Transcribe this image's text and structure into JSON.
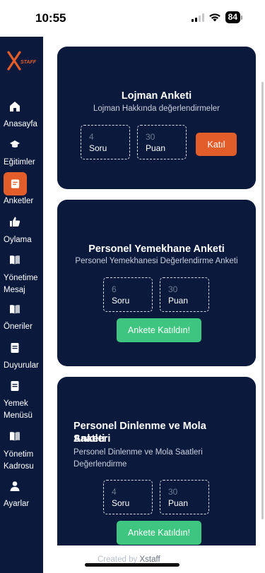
{
  "status_bar": {
    "time": "10:55",
    "battery": "84"
  },
  "sidebar": {
    "logo_text": "STAFF",
    "items": [
      {
        "label": "Anasayfa",
        "icon": "home-icon"
      },
      {
        "label": "Eğitimler",
        "icon": "graduation-cap-icon"
      },
      {
        "label": "Anketler",
        "icon": "survey-icon",
        "active": true
      },
      {
        "label": "Oylama",
        "icon": "thumbs-up-icon"
      },
      {
        "label": "Yönetime Mesaj",
        "line1": "Yönetime",
        "line2": "Mesaj",
        "icon": "book-icon"
      },
      {
        "label": "Öneriler",
        "icon": "book-icon"
      },
      {
        "label": "Duyurular",
        "icon": "document-icon"
      },
      {
        "label": "Yemek Menüsü",
        "line1": "Yemek",
        "line2": "Menüsü",
        "icon": "document-icon"
      },
      {
        "label": "Yönetim Kadrosu",
        "line1": "Yönetim",
        "line2": "Kadrosu",
        "icon": "book-icon"
      },
      {
        "label": "Ayarlar",
        "icon": "user-icon"
      }
    ]
  },
  "surveys": [
    {
      "title": "Lojman Anketi",
      "subtitle": "Lojman Hakkında değerlendirmeler",
      "questions_count": "4",
      "questions_label": "Soru",
      "points_count": "30",
      "points_label": "Puan",
      "action_label": "Katıl"
    },
    {
      "title": "Personel Yemekhane Anketi",
      "subtitle": "Personel Yemekhanesi Değerlendirme Anketi",
      "questions_count": "6",
      "questions_label": "Soru",
      "points_count": "30",
      "points_label": "Puan",
      "action_label": "Ankete Katıldın!"
    },
    {
      "title_line1": "Personel Dinlenme ve Mola Saatleri",
      "title_line2": "Anketi",
      "subtitle_line1": "Personel Dinlenme ve Mola Saatleri",
      "subtitle_line2": "Değerlendirme",
      "questions_count": "4",
      "questions_label": "Soru",
      "points_count": "30",
      "points_label": "Puan",
      "action_label": "Ankete Katıldın!"
    }
  ],
  "footer": {
    "created_by": "Created by",
    "brand": "Xstaff"
  },
  "colors": {
    "navy": "#0b1a3c",
    "orange": "#e35d2a",
    "green": "#3ec57f"
  }
}
